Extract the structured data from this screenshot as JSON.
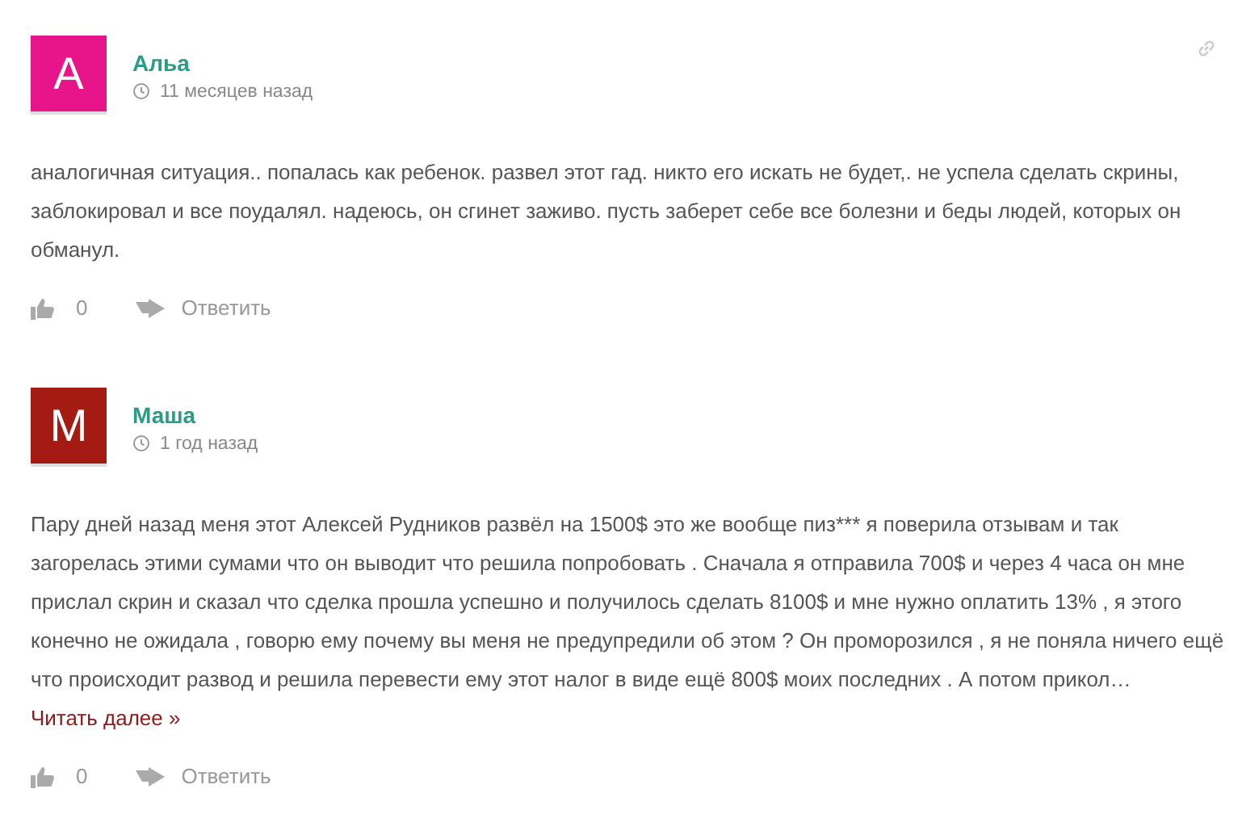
{
  "comments": [
    {
      "avatar_letter": "А",
      "color": "#e8158a",
      "author": "Альа",
      "time": "11 месяцев назад",
      "show_link": true,
      "text": "аналогичная ситуация.. попалась как ребенок. развел этот гад. никто его искать не будет,. не успела сделать скрины, заблокировал и все поудалял. надеюсь, он сгинет заживо. пусть заберет себе все болезни и беды людей, которых он обманул.",
      "likes": "0",
      "reply": "Ответить"
    },
    {
      "avatar_letter": "М",
      "color": "#a31b12",
      "author": "Маша",
      "time": "1 год назад",
      "show_link": false,
      "text": "Пару дней назад меня этот Алексей Рудников развёл на 1500$ это же вообще пиз*** я поверила отзывам и так загорелась этими сумами что он выводит что решила попробовать . Сначала я отправила 700$ и через 4 часа он мне прислал скрин и сказал что сделка прошла успешно и получилось сделать 8100$ и мне нужно оплатить 13% , я этого конечно не ожидала , говорю ему почему вы меня не предупредили об этом ? Он проморозился , я не поняла ничего ещё что происходит развод и решила перевести ему этот налог в виде ещё 800$ моих последних . А потом прикол…",
      "read_more": "Читать далее »",
      "likes": "0",
      "reply": "Ответить"
    }
  ]
}
